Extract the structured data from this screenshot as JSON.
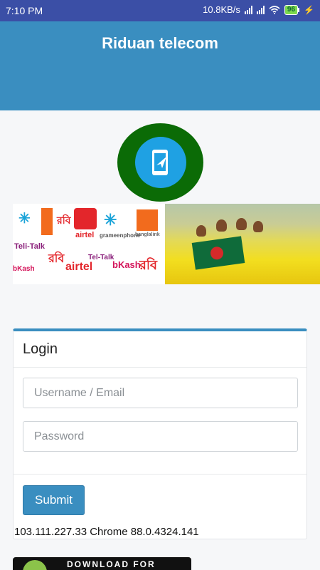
{
  "status_bar": {
    "time": "7:10 PM",
    "net_speed": "10.8KB/s",
    "battery": "96"
  },
  "header": {
    "title": "Riduan telecom"
  },
  "banner": {
    "operators": [
      "airtel",
      "grameenphone",
      "Teli-Talk",
      "bKash",
      "রবি",
      "banglalink"
    ]
  },
  "login": {
    "title": "Login",
    "username_placeholder": "Username / Email",
    "password_placeholder": "Password",
    "submit_label": "Submit",
    "client_info": "103.111.227.33 Chrome 88.0.4324.141"
  },
  "download": {
    "label": "DOWNLOAD FOR"
  },
  "colors": {
    "status_bar": "#3b4fa6",
    "header": "#3a8ec0",
    "logo_outer": "#0b6b06",
    "logo_inner": "#1fa1e3"
  }
}
